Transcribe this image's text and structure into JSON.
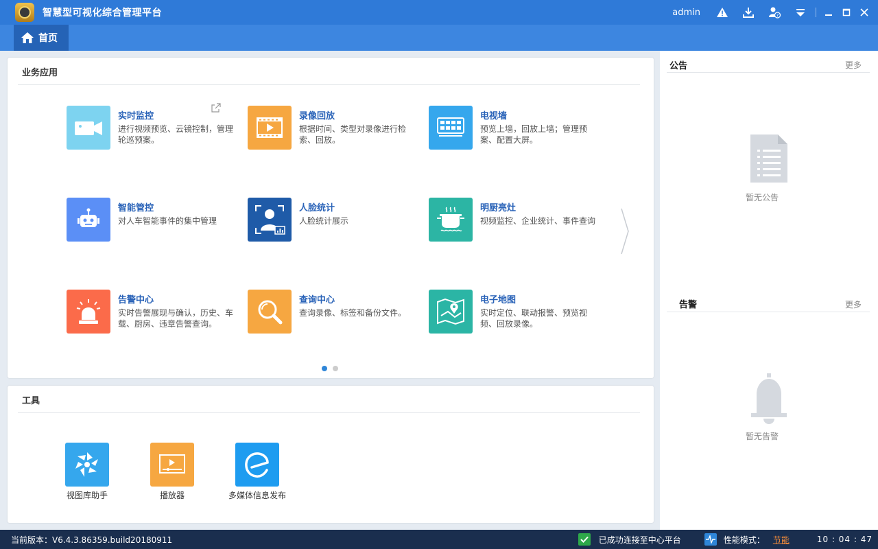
{
  "titlebar": {
    "app_title": "智慧型可视化综合管理平台",
    "user": "admin"
  },
  "nav": {
    "home_label": "首页"
  },
  "business": {
    "title": "业务应用",
    "apps": [
      {
        "name": "实时监控",
        "desc": "进行视频预览、云镜控制，管理轮巡预案。",
        "color": "#7dd3f0",
        "icon": "camera-icon"
      },
      {
        "name": "录像回放",
        "desc": "根据时间、类型对录像进行检索、回放。",
        "color": "#f6a741",
        "icon": "video-playback-icon"
      },
      {
        "name": "电视墙",
        "desc": "预览上墙，回放上墙；管理预案、配置大屏。",
        "color": "#35a7ed",
        "icon": "tv-wall-icon"
      },
      {
        "name": "智能管控",
        "desc": "对人车智能事件的集中管理",
        "color": "#5b8ff6",
        "icon": "robot-icon"
      },
      {
        "name": "人脸统计",
        "desc": "人脸统计展示",
        "color": "#1f5ba8",
        "icon": "face-stats-icon"
      },
      {
        "name": "明厨亮灶",
        "desc": "视频监控、企业统计、事件查询",
        "color": "#2cb5a4",
        "icon": "kitchen-pot-icon"
      },
      {
        "name": "告警中心",
        "desc": "实时告警展现与确认，历史、车载、厨房、违章告警查询。",
        "color": "#fb6b4a",
        "icon": "alarm-light-icon"
      },
      {
        "name": "查询中心",
        "desc": "查询录像、标签和备份文件。",
        "color": "#f6a741",
        "icon": "magnifier-icon"
      },
      {
        "name": "电子地图",
        "desc": "实时定位、联动报警、预览视频、回放录像。",
        "color": "#2bb5a5",
        "icon": "map-icon"
      }
    ]
  },
  "tools": {
    "title": "工具",
    "items": [
      {
        "name": "视图库助手",
        "color": "#35a7ed",
        "icon": "flower-icon"
      },
      {
        "name": "播放器",
        "color": "#f6a741",
        "icon": "player-icon"
      },
      {
        "name": "多媒体信息发布",
        "color": "#1e9cf0",
        "icon": "media-publish-icon"
      }
    ]
  },
  "notice": {
    "title": "公告",
    "more": "更多",
    "empty": "暂无公告"
  },
  "alarm": {
    "title": "告警",
    "more": "更多",
    "empty": "暂无告警"
  },
  "status": {
    "version": "当前版本：V6.4.3.86359.build20180911",
    "connection": "已成功连接至中心平台",
    "perf_label": "性能模式：",
    "perf_value": "节能",
    "clock": "10 : 04 : 47"
  }
}
